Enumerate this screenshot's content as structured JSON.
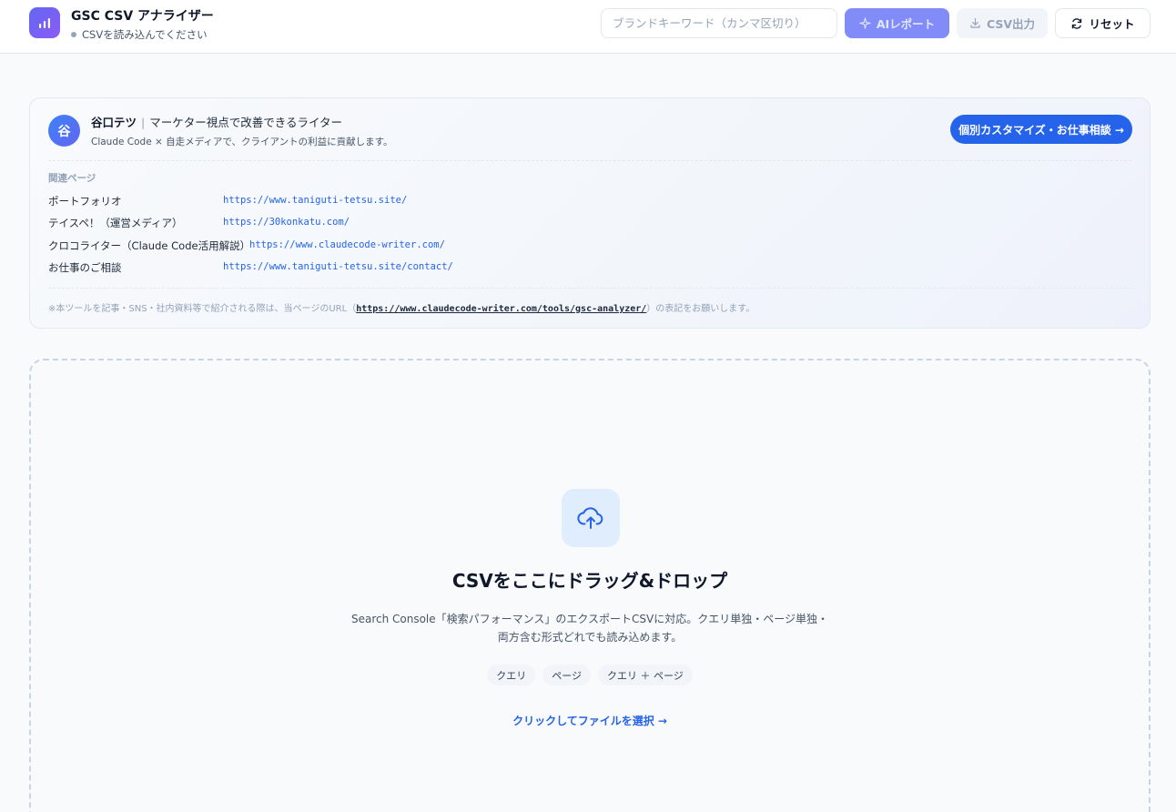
{
  "header": {
    "app_title": "GSC CSV アナライザー",
    "status_text": "CSVを読み込んでください",
    "brand_placeholder": "ブランドキーワード（カンマ区切り）",
    "ai_report_label": "AIレポート",
    "csv_export_label": "CSV出力",
    "reset_label": "リセット"
  },
  "author": {
    "avatar_initial": "谷",
    "name": "谷口テツ",
    "separator": "|",
    "tagline": "マーケター視点で改善できるライター",
    "description": "Claude Code × 自走メディアで、クライアントの利益に貢献します。",
    "consult_button": "個別カスタマイズ・お仕事相談 →",
    "related_title": "関連ページ",
    "links": [
      {
        "label": "ポートフォリオ",
        "url": "https://www.taniguti-tetsu.site/"
      },
      {
        "label": "テイスペ！（運営メディア）",
        "url": "https://30konkatu.com/"
      },
      {
        "label": "クロコライター（Claude Code活用解説）",
        "url": "https://www.claudecode-writer.com/"
      },
      {
        "label": "お仕事のご相談",
        "url": "https://www.taniguti-tetsu.site/contact/"
      }
    ],
    "notice_prefix": "※本ツールを記事・SNS・社内資料等で紹介される際は、当ページのURL（",
    "notice_url": "https://www.claudecode-writer.com/tools/gsc-analyzer/",
    "notice_suffix": "）の表記をお願いします。"
  },
  "dropzone": {
    "title": "CSVをここにドラッグ&ドロップ",
    "description": "Search Console「検索パフォーマンス」のエクスポートCSVに対応。クエリ単独・ページ単独・両方含む形式どれでも読み込めます。",
    "chips": [
      "クエリ",
      "ページ",
      "クエリ ＋ ページ"
    ],
    "select_link": "クリックしてファイルを選択 →"
  },
  "colors": {
    "accent": "#2563eb",
    "ai_button": "#818cf8",
    "logo_gradient_start": "#6366f1",
    "logo_gradient_end": "#8b5cf6"
  },
  "icons": {
    "logo": "bar-chart-icon",
    "ai": "sparkle-icon",
    "export": "download-icon",
    "reset": "refresh-icon",
    "upload": "cloud-upload-icon"
  }
}
